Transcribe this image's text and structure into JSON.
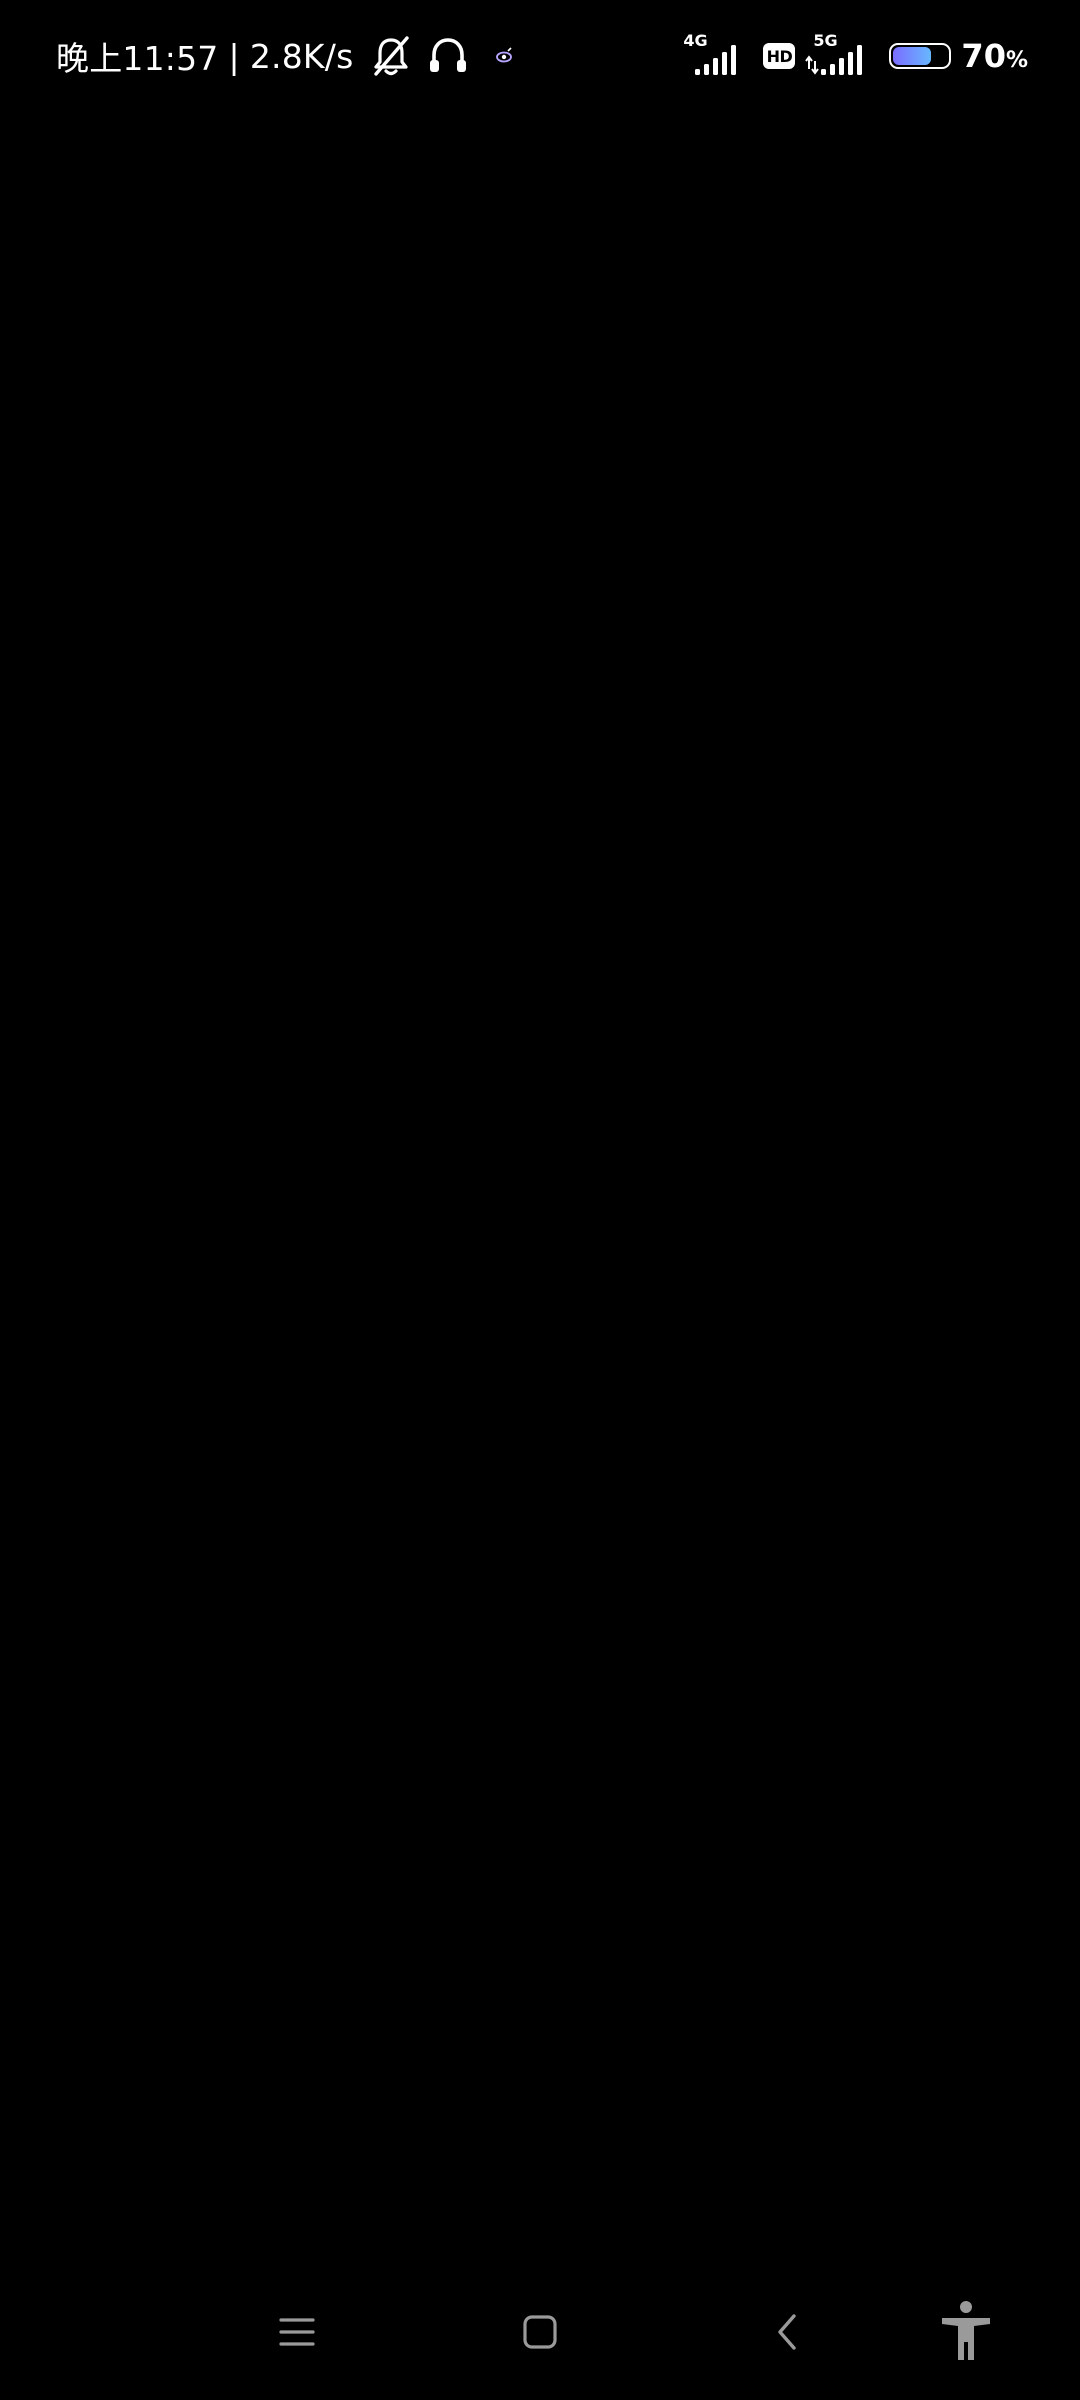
{
  "status_bar": {
    "time": "晚上11:57",
    "separator": "|",
    "net_speed": "2.8K/s",
    "left_icons": [
      "bell-off-icon",
      "headset-icon",
      "eye-icon"
    ],
    "sim1_network": "4G",
    "hd_label": "HD",
    "sim2_network": "5G",
    "battery_level": 70,
    "battery_number": "70",
    "battery_unit": "%",
    "battery_color": "#7b6cff"
  },
  "nav_bar": {
    "buttons": [
      "recents-icon",
      "home-icon",
      "back-icon",
      "accessibility-icon"
    ]
  }
}
